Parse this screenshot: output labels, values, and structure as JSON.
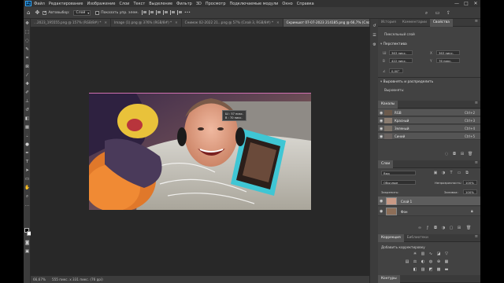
{
  "menubar": {
    "logo": "Ps",
    "items": [
      "Файл",
      "Редактирование",
      "Изображение",
      "Слои",
      "Текст",
      "Выделение",
      "Фильтр",
      "3D",
      "Просмотр",
      "Подключаемые модули",
      "Окно",
      "Справка"
    ],
    "window_controls": [
      "—",
      "□",
      "✕"
    ]
  },
  "options_bar": {
    "auto_select_label": "Автовыбор:",
    "auto_select_value": "Слой",
    "show_transform_label": "Показать упр. элем."
  },
  "doc_tabs": [
    {
      "label": "...2023_195555.png @ 157% (RGB/8#) *",
      "active": false
    },
    {
      "label": "Image (1).png @ 376% (RGB/8#) *",
      "active": false
    },
    {
      "label": "Снимок 02-2022 21...png @ 57% (Слой 3, RGB/8#) *",
      "active": false
    },
    {
      "label": "Скриншот 07-07-2023 214185.png @ 66,7% (Слой 1, RGB/8#) *",
      "active": true
    }
  ],
  "measure_tooltip": {
    "w": "Ш : 57 пикс.",
    "h": "В : 70 пикс."
  },
  "statusbar": {
    "zoom": "66,67%",
    "size": "555 пикс. x 331 пикс. (76 ppi)"
  },
  "properties_panel": {
    "tabs": [
      "История",
      "Комментарии",
      "Свойства"
    ],
    "active_tab": "Свойства",
    "layer_type": "Пиксельный слой",
    "transform_title": "Перспектива",
    "w_value": "363 пикс.",
    "x_value": "363 пикс.",
    "h_value": "422 пикс.",
    "y_value": "76 пикс.",
    "angle_value": "0,00°",
    "align_title": "Выровнять и распределить",
    "align_sub": "Выровнять:"
  },
  "channels_panel": {
    "tab": "Каналы",
    "rows": [
      {
        "label": "RGB",
        "shortcut": "Ctrl+2"
      },
      {
        "label": "Красный",
        "shortcut": "Ctrl+3"
      },
      {
        "label": "Зеленый",
        "shortcut": "Ctrl+4"
      },
      {
        "label": "Синий",
        "shortcut": "Ctrl+5"
      }
    ]
  },
  "layers_panel": {
    "tab": "Слои",
    "filter_label": "Вид",
    "blend_mode": "Обычные",
    "opacity_label": "Непрозрачность:",
    "opacity_value": "100%",
    "lock_label": "Закрепить:",
    "fill_label": "Заливка:",
    "fill_value": "100%",
    "rows": [
      {
        "label": "Слой 1",
        "selected": true
      },
      {
        "label": "Фон",
        "selected": false
      }
    ]
  },
  "adjustments_panel": {
    "tabs": [
      "Коррекция",
      "Библиотеки"
    ],
    "add_label": "Добавить корректировку",
    "paths_tab": "Контуры"
  },
  "colors": {
    "app_bg": "#535353",
    "menubar_bg": "#323232",
    "canvas_bg": "#282828",
    "accent_guide": "#d06fb0",
    "ps_blue": "#31a8ff"
  }
}
